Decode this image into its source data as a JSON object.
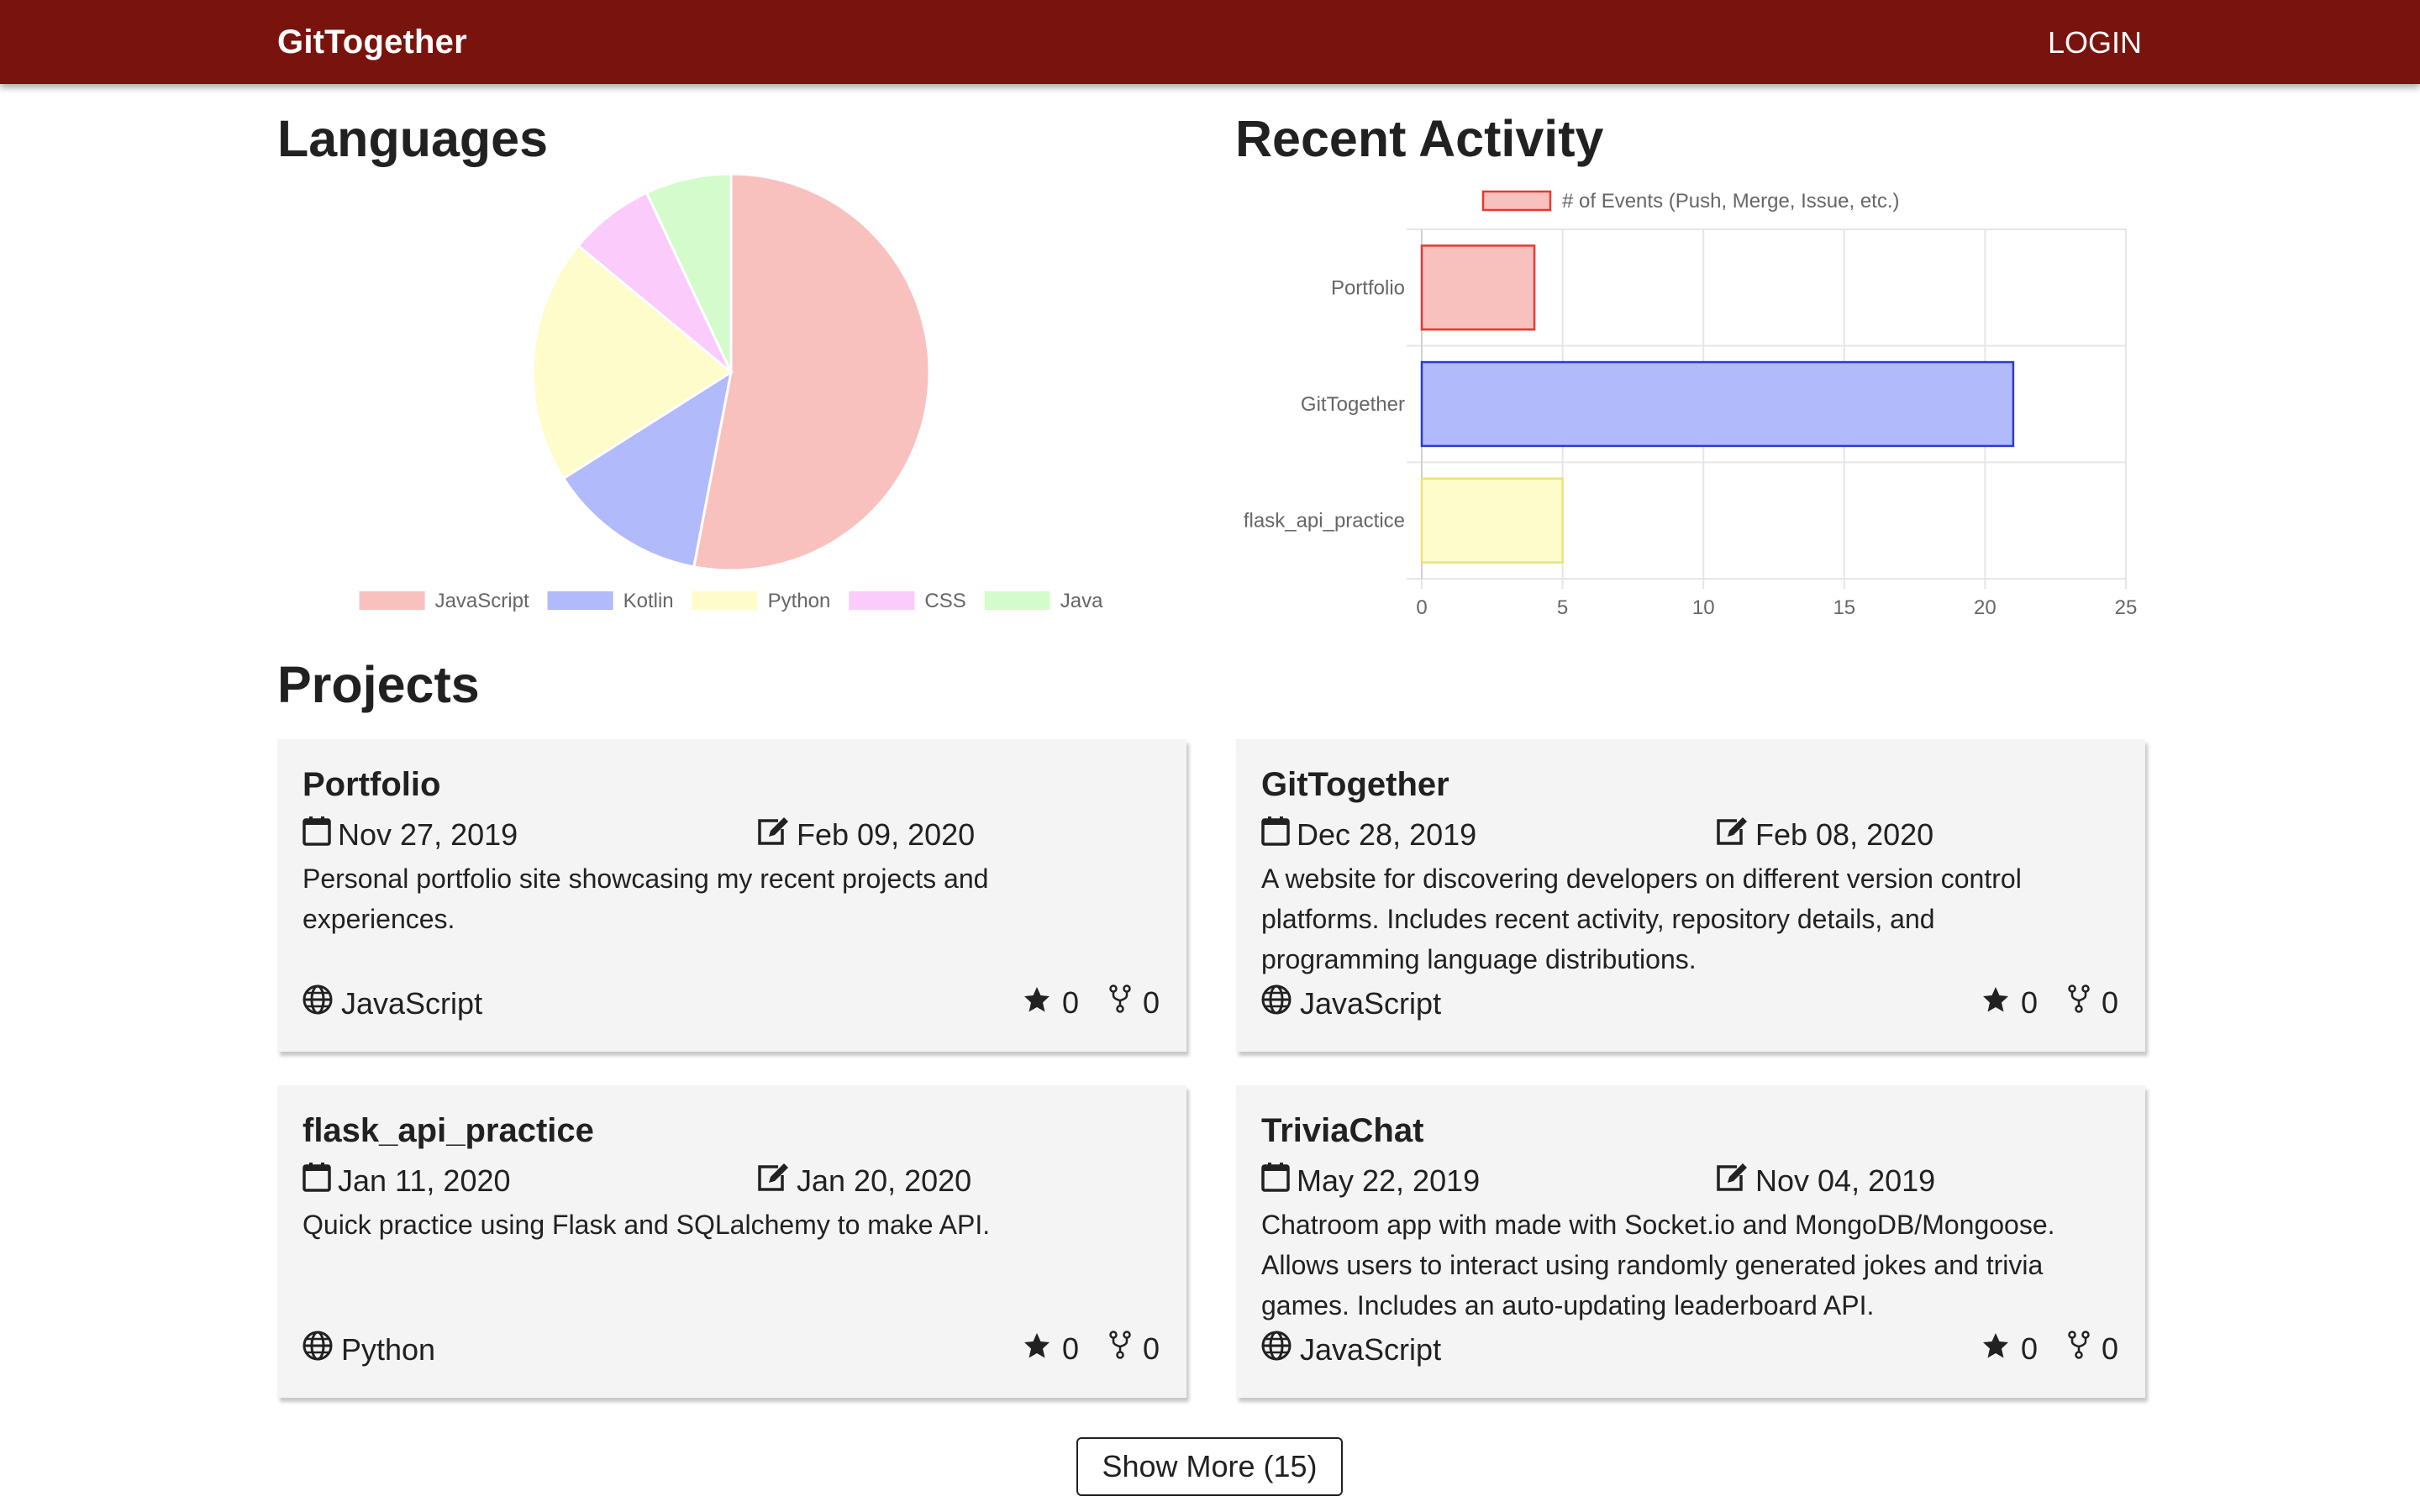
{
  "app": {
    "brand": "GitTogether",
    "login_label": "LOGIN",
    "nav_color": "#79130d"
  },
  "sections": {
    "languages_title": "Languages",
    "activity_title": "Recent Activity",
    "projects_title": "Projects"
  },
  "chart_data": [
    {
      "type": "pie",
      "title": "Languages",
      "categories": [
        "JavaScript",
        "Kotlin",
        "Python",
        "CSS",
        "Java"
      ],
      "values": [
        53,
        13,
        20,
        7,
        7
      ],
      "colors": [
        "#f8c1be",
        "#b1bafb",
        "#fefccb",
        "#facbfb",
        "#d4fbcb"
      ],
      "legend": "bottom"
    },
    {
      "type": "bar",
      "orientation": "horizontal",
      "title": "Recent Activity",
      "legend_label": "# of Events (Push, Merge, Issue, etc.)",
      "legend": "top",
      "categories": [
        "Portfolio",
        "GitTogether",
        "flask_api_practice"
      ],
      "values": [
        4,
        21,
        5
      ],
      "fill_colors": [
        "#f8c1be",
        "#b1bafb",
        "#fefccb"
      ],
      "border_colors": [
        "#e33a35",
        "#2d3ad4",
        "#e7e37d"
      ],
      "xlim": [
        0,
        25
      ],
      "xticks": [
        "0",
        "5",
        "10",
        "15",
        "20",
        "25"
      ],
      "grid": true
    }
  ],
  "projects": [
    {
      "name": "Portfolio",
      "created": "Nov 27, 2019",
      "updated": "Feb 09, 2020",
      "description": "Personal portfolio site showcasing my recent projects and experiences.",
      "language": "JavaScript",
      "stars": "0",
      "forks": "0"
    },
    {
      "name": "GitTogether",
      "created": "Dec 28, 2019",
      "updated": "Feb 08, 2020",
      "description": "A website for discovering developers on different version control platforms. Includes recent activity, repository details, and programming language distributions.",
      "language": "JavaScript",
      "stars": "0",
      "forks": "0"
    },
    {
      "name": "flask_api_practice",
      "created": "Jan 11, 2020",
      "updated": "Jan 20, 2020",
      "description": "Quick practice using Flask and SQLalchemy to make API.",
      "language": "Python",
      "stars": "0",
      "forks": "0"
    },
    {
      "name": "TriviaChat",
      "created": "May 22, 2019",
      "updated": "Nov 04, 2019",
      "description": "Chatroom app with made with Socket.io and MongoDB/Mongoose. Allows users to interact using randomly generated jokes and trivia games. Includes an auto-updating leaderboard API.",
      "language": "JavaScript",
      "stars": "0",
      "forks": "0"
    }
  ],
  "show_more_label": "Show More (15)",
  "icons": {
    "created": "calendar-icon",
    "updated": "edit-icon",
    "language": "globe-icon",
    "stars": "star-icon",
    "forks": "fork-icon"
  }
}
